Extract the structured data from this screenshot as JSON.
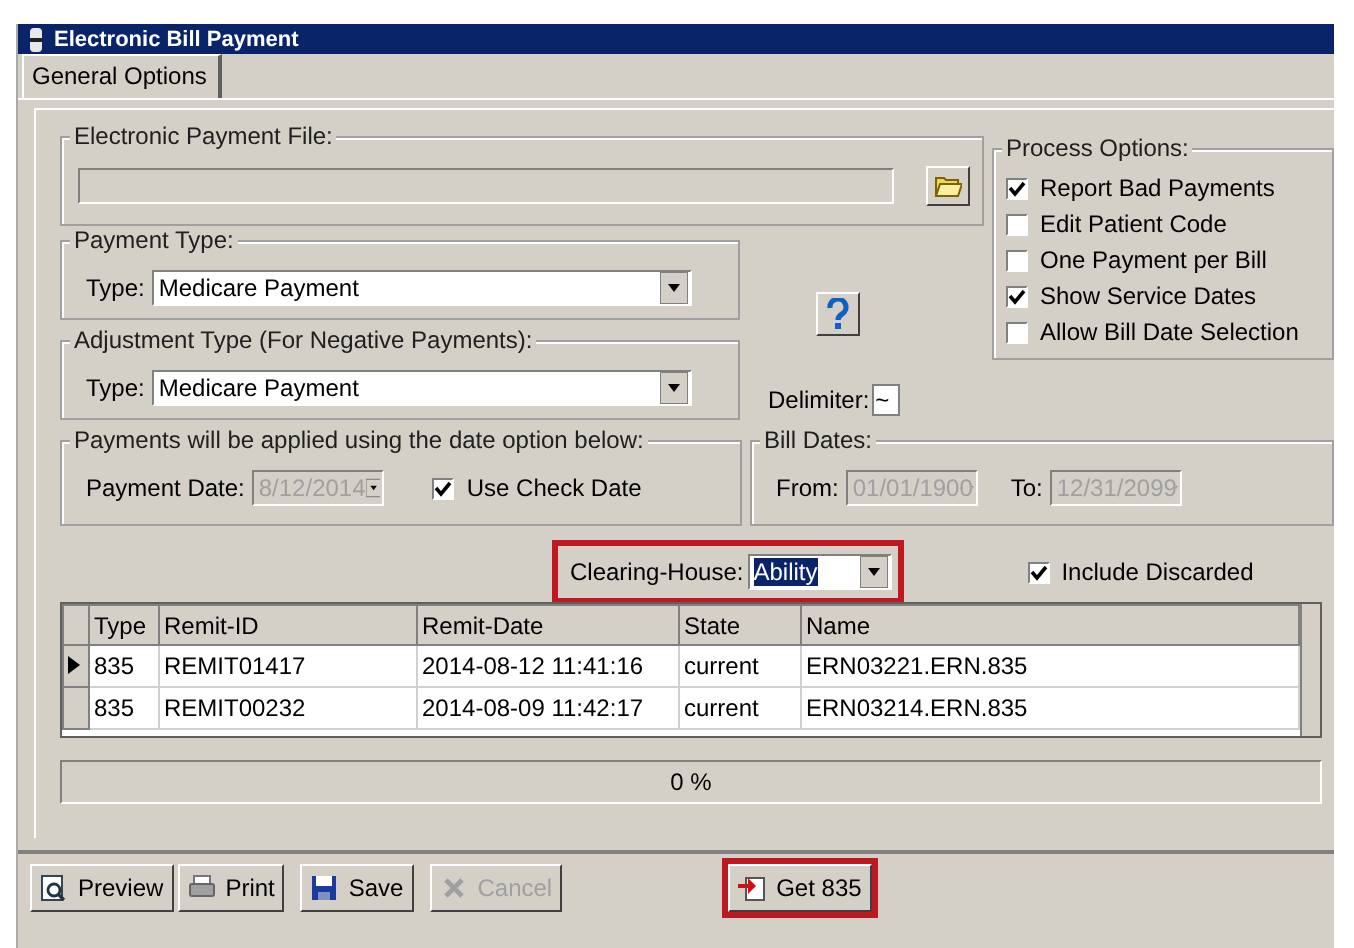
{
  "window": {
    "title": "Electronic Bill Payment"
  },
  "tabs": [
    {
      "label": "General Options",
      "selected": true
    }
  ],
  "payment_file": {
    "legend": "Electronic Payment File:"
  },
  "payment_type": {
    "legend": "Payment Type:",
    "label": "Type:",
    "value": "Medicare Payment"
  },
  "adjustment_type": {
    "legend": "Adjustment Type (For Negative Payments):",
    "label": "Type:",
    "value": "Medicare Payment"
  },
  "process_options": {
    "legend": "Process Options:",
    "items": [
      {
        "label": "Report Bad Payments",
        "checked": true
      },
      {
        "label": "Edit Patient Code",
        "checked": false
      },
      {
        "label": "One Payment per Bill",
        "checked": false
      },
      {
        "label": "Show Service Dates",
        "checked": true
      },
      {
        "label": "Allow Bill Date Selection",
        "checked": false
      }
    ]
  },
  "delimiter": {
    "label": "Delimiter:",
    "value": "~"
  },
  "date_option": {
    "legend": "Payments will be applied using the date option below:",
    "label": "Payment Date:",
    "value": "8/12/2014",
    "disabled": true,
    "check_label": "Use Check Date",
    "checked": true
  },
  "bill_dates": {
    "legend": "Bill Dates:",
    "from_label": "From:",
    "from": "01/01/1900",
    "to_label": "To:",
    "to": "12/31/2099",
    "disabled": true
  },
  "clearing_house": {
    "label": "Clearing-House:",
    "value": "Ability",
    "highlighted": true
  },
  "include_discarded": {
    "label": "Include Discarded",
    "checked": true
  },
  "table": {
    "columns": [
      "Type",
      "Remit-ID",
      "Remit-Date",
      "State",
      "Name"
    ],
    "rows": [
      {
        "cells": [
          "835",
          "REMIT01417",
          "2014-08-12 11:41:16",
          "current",
          "ERN03221.ERN.835"
        ],
        "selected": true
      },
      {
        "cells": [
          "835",
          "REMIT00232",
          "2014-08-09 11:42:17",
          "current",
          "ERN03214.ERN.835"
        ],
        "selected": false
      }
    ]
  },
  "progress": {
    "level": 0,
    "reading": "0 %"
  },
  "toolbar": [
    {
      "kind": "preview",
      "label": "Preview",
      "disabled": false,
      "highlighted": false
    },
    {
      "kind": "print",
      "label": "Print",
      "disabled": false,
      "highlighted": false
    },
    {
      "kind": "save",
      "label": "Save",
      "disabled": false,
      "highlighted": false
    },
    {
      "kind": "cancel",
      "label": "Cancel",
      "disabled": true,
      "highlighted": false
    },
    {
      "kind": "get",
      "label": "Get 835",
      "disabled": false,
      "highlighted": true
    }
  ]
}
